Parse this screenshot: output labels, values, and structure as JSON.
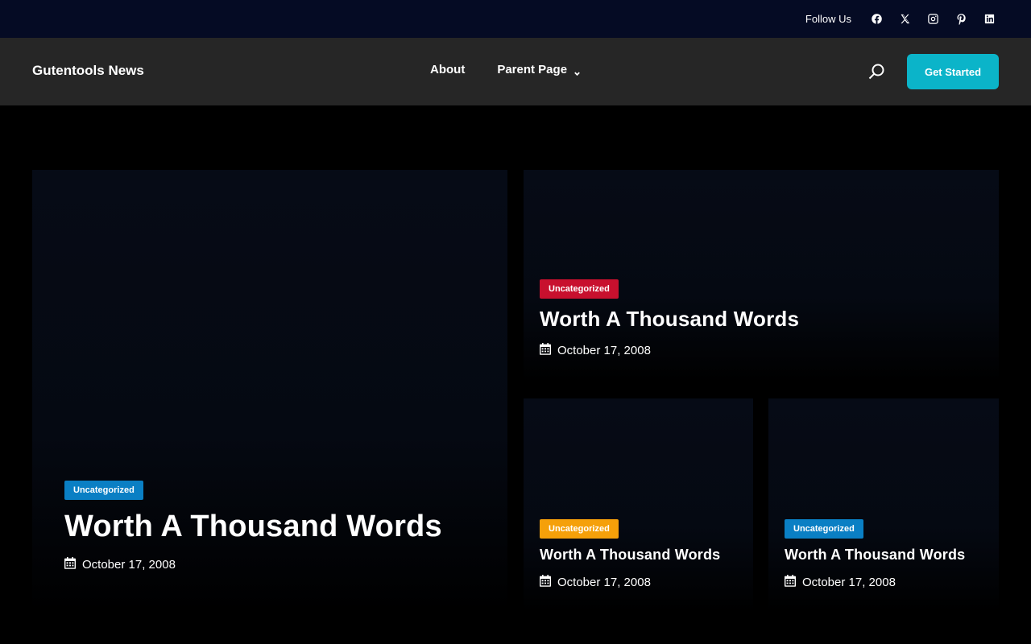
{
  "topbar": {
    "follow_label": "Follow Us",
    "socials": [
      "facebook-icon",
      "x-icon",
      "instagram-icon",
      "pinterest-icon",
      "linkedin-icon"
    ],
    "background": "#050b24"
  },
  "header": {
    "site_title": "Gutentools News",
    "nav": {
      "about": "About",
      "parent_page": "Parent Page"
    },
    "cta_label": "Get Started",
    "cta_color": "#0bb4c9",
    "background": "#262626"
  },
  "posts": [
    {
      "category": "Uncategorized",
      "category_color": "#0a7fc4",
      "title": "Worth A Thousand Words",
      "date": "October 17, 2008"
    },
    {
      "category": "Uncategorized",
      "category_color": "#c8102e",
      "title": "Worth A Thousand Words",
      "date": "October 17, 2008"
    },
    {
      "category": "Uncategorized",
      "category_color": "#f5a00a",
      "title": "Worth A Thousand Words",
      "date": "October 17, 2008"
    },
    {
      "category": "Uncategorized",
      "category_color": "#0a7fc4",
      "title": "Worth A Thousand Words",
      "date": "October 17, 2008"
    }
  ]
}
